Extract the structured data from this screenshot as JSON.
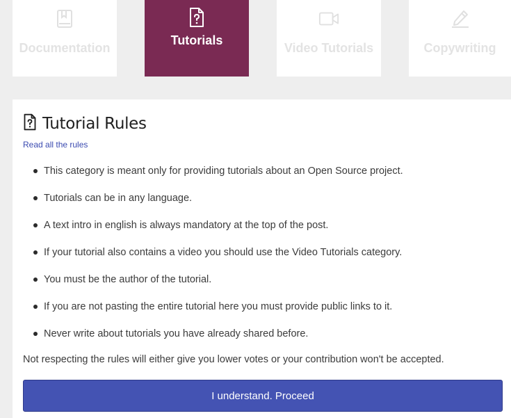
{
  "tabs": [
    {
      "id": "documentation",
      "label": "Documentation",
      "icon": "book-icon",
      "active": false
    },
    {
      "id": "tutorials",
      "label": "Tutorials",
      "icon": "question-document-icon",
      "active": true
    },
    {
      "id": "video_tutorials",
      "label": "Video Tutorials",
      "icon": "video-camera-icon",
      "active": false
    },
    {
      "id": "copywriting",
      "label": "Copywriting",
      "icon": "pencil-icon",
      "active": false
    }
  ],
  "colors": {
    "active_tab_bg": "#7a2a53",
    "inactive_tab_text": "#e3e3e3",
    "button_bg": "#4453b3",
    "link": "#3a4ab0"
  },
  "rules": {
    "title": "Tutorial Rules",
    "title_icon": "question-document-icon",
    "read_all_link": "Read all the rules",
    "items": [
      "This category is meant only for providing tutorials about an Open Source project.",
      "Tutorials can be in any language.",
      "A text intro in english is always mandatory at the top of the post.",
      "If your tutorial also contains a video you should use the Video Tutorials category.",
      "You must be the author of the tutorial.",
      "If you are not pasting the entire tutorial here you must provide public links to it.",
      "Never write about tutorials you have already shared before."
    ],
    "footer_note": "Not respecting the rules will either give you lower votes or your contribution won't be accepted.",
    "proceed_label": "I understand. Proceed"
  }
}
